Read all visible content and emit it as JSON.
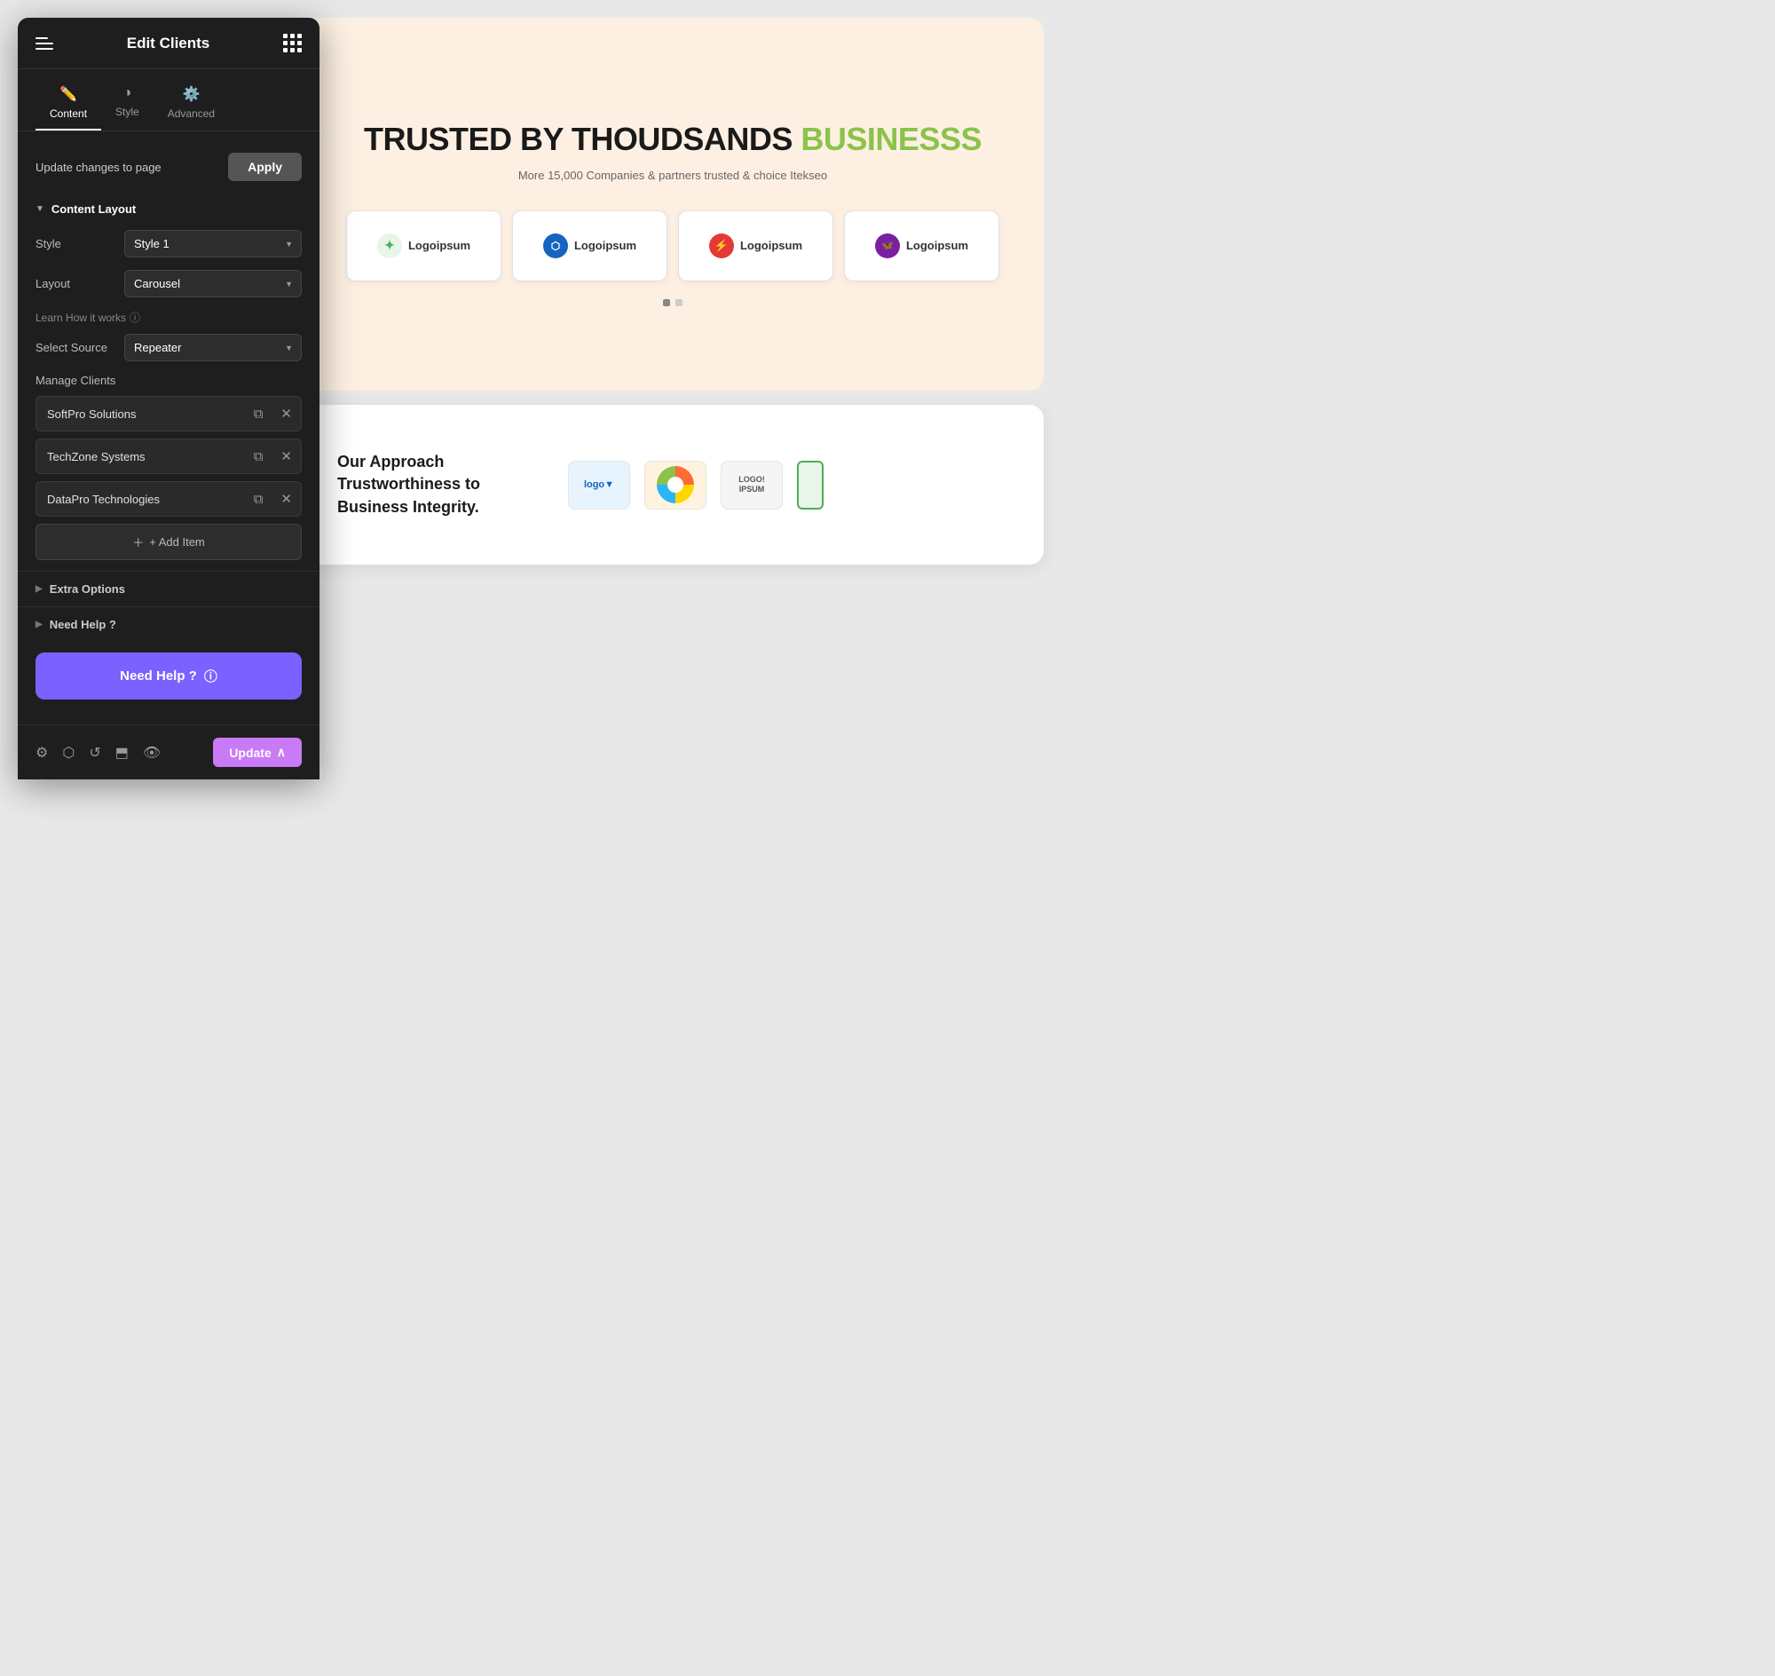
{
  "sidebar": {
    "title": "Edit Clients",
    "tabs": [
      {
        "label": "Content",
        "icon": "✏️",
        "active": true
      },
      {
        "label": "Style",
        "icon": "◑",
        "active": false
      },
      {
        "label": "Advanced",
        "icon": "⚙️",
        "active": false
      }
    ],
    "apply_label": "Update changes to page",
    "apply_button": "Apply",
    "content_layout": {
      "section_label": "Content Layout",
      "style_label": "Style",
      "style_value": "Style 1",
      "layout_label": "Layout",
      "layout_value": "Carousel",
      "learn_link": "Learn How it works",
      "source_label": "Select Source",
      "source_value": "Repeater"
    },
    "manage_clients": {
      "label": "Manage Clients",
      "items": [
        {
          "name": "SoftPro Solutions"
        },
        {
          "name": "TechZone Systems"
        },
        {
          "name": "DataPro Technologies"
        }
      ],
      "add_item_label": "+ Add Item"
    },
    "extra_options": {
      "label": "Extra Options"
    },
    "need_help_section": {
      "label": "Need Help ?"
    },
    "need_help_button": "Need Help ?",
    "update_button": "Update",
    "footer_icons": [
      "⚙",
      "⬡",
      "↺",
      "⬒",
      "👁"
    ]
  },
  "preview": {
    "title_black": "TRUSTED BY THOUDSANDS",
    "title_green": "BUSINESSS",
    "subtitle": "More 15,000 Companies & partners trusted & choice Itekseo",
    "logos": [
      {
        "name": "Logoipsum",
        "icon_color": "green"
      },
      {
        "name": "Logoipsum",
        "icon_color": "blue"
      },
      {
        "name": "Logoipsum",
        "icon_color": "red"
      },
      {
        "name": "Logoipsum",
        "icon_color": "purple"
      }
    ],
    "bottom_text": "Our Approach Trustworthiness to Business Integrity.",
    "bottom_logos": [
      {
        "label": "logo"
      },
      {
        "label": "🌐"
      },
      {
        "label": "LOGO!\nIPSUM"
      }
    ]
  }
}
